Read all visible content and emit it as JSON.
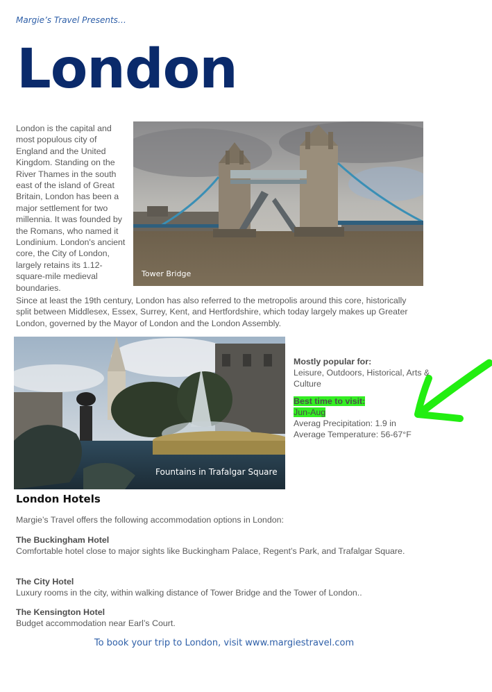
{
  "header": {
    "presents": "Margie’s Travel Presents…",
    "title": "London"
  },
  "intro": {
    "narrow_text": "London is the capital and most populous city of England and the United Kingdom. Standing on the River Thames in the south east of the island of Great Britain, London has been a major settlement for two millennia. It was founded by the Romans, who named it Londinium. London's ancient core, the City of London, largely retains its 1.12-square-mile medieval boundaries.",
    "wide_text": "Since at least the 19th century, London has also referred to the metropolis around this core, historically split between Middlesex, Essex, Surrey, Kent, and Hertfordshire, which today largely makes up Greater London, governed by the Mayor of London and the London Assembly."
  },
  "images": {
    "tower_bridge_caption": "Tower Bridge",
    "trafalgar_caption": "Fountains in Trafalgar Square"
  },
  "sidebar": {
    "popular_label": "Mostly popular for:",
    "popular_value": "Leisure, Outdoors, Historical, Arts & Culture",
    "best_time_label": "Best time to visit:",
    "best_time_value": "Jun-Aug",
    "precip": "Averag Precipitation: 1.9 in",
    "temp": "Average Temperature: 56-67°F"
  },
  "hotels": {
    "heading": "London Hotels",
    "intro": "Margie’s Travel offers the following accommodation options in London:",
    "items": [
      {
        "name": "The Buckingham Hotel",
        "desc": "Comfortable hotel close to major sights like Buckingham Palace, Regent’s Park, and Trafalgar Square."
      },
      {
        "name": "The City Hotel",
        "desc": "Luxury rooms in the city, within walking distance of Tower Bridge and the Tower of London.."
      },
      {
        "name": "The Kensington Hotel",
        "desc": "Budget accommodation near Earl’s Court."
      }
    ]
  },
  "footer": {
    "text": "To book your trip to London, visit www.margiestravel.com"
  },
  "colors": {
    "title": "#0a2a6b",
    "accent_blue": "#2e5fa8",
    "highlight_green": "#33ee22",
    "annotation_arrow": "#22ee11"
  },
  "icons": {
    "annotation": "green-arrow-icon"
  }
}
